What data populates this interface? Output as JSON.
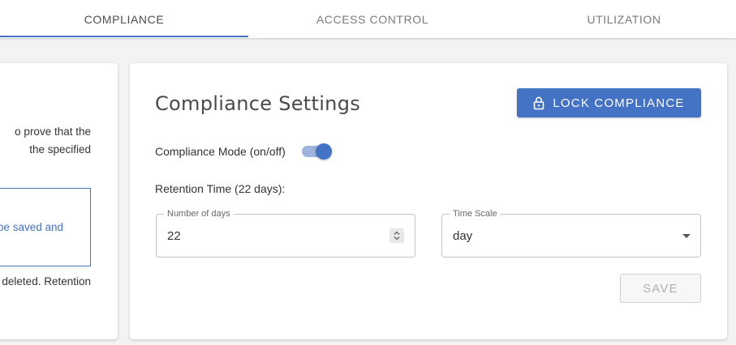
{
  "tabs": [
    {
      "label": "COMPLIANCE",
      "active": true
    },
    {
      "label": "ACCESS CONTROL",
      "active": false
    },
    {
      "label": "UTILIZATION",
      "active": false
    }
  ],
  "left_card": {
    "fragments": [
      "o prove that the",
      "the specified",
      "be saved and",
      "deleted. Retention"
    ]
  },
  "settings": {
    "title": "Compliance Settings",
    "lock_button": "LOCK COMPLIANCE",
    "lock_icon": "lock-icon",
    "mode_label": "Compliance Mode (on/off)",
    "mode_enabled": true,
    "retention_label": "Retention Time (22 days):",
    "days_field": {
      "label": "Number of days",
      "value": "22"
    },
    "scale_field": {
      "label": "Time Scale",
      "value": "day"
    },
    "save_button": "SAVE",
    "save_disabled": true
  },
  "colors": {
    "accent": "#4472c4",
    "toggle_track": "#9fb4dc",
    "background": "#f3f3f3"
  }
}
